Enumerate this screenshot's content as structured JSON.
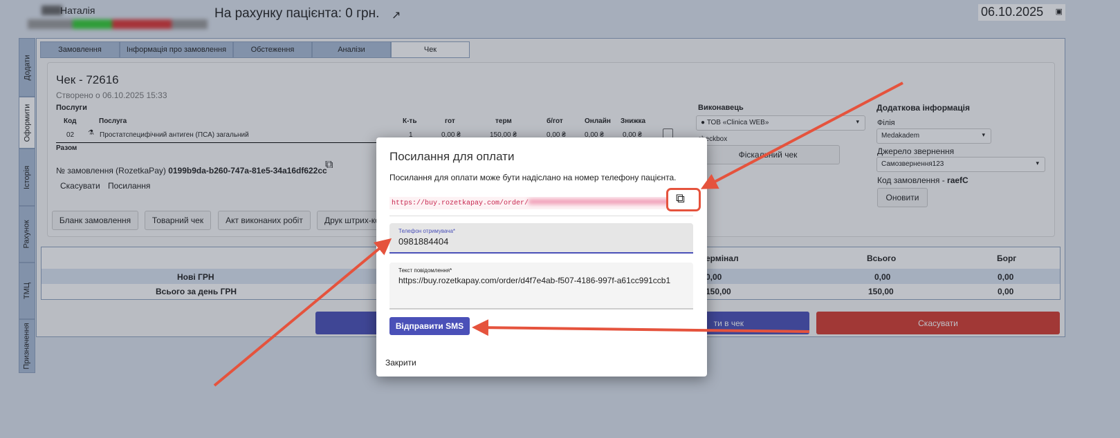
{
  "header": {
    "patient_name": "Наталія",
    "balance": "На рахунку пацієнта: 0 грн.",
    "date": "06.10.2025"
  },
  "side_tabs": [
    "Додати",
    "Оформити",
    "Історія",
    "Рахунок",
    "ТМЦ",
    "Призначення"
  ],
  "tabs": [
    "Замовлення",
    "Інформація про замовлення",
    "Обстеження",
    "Аналізи",
    "Чек"
  ],
  "check": {
    "title": "Чек - 72616",
    "created": "Створено о 06.10.2025 15:33",
    "services_label": "Послуги",
    "columns": [
      "Код",
      "Послуга",
      "К-ть",
      "гот",
      "терм",
      "б/гот",
      "Онлайн",
      "Знижка"
    ],
    "row": [
      "02",
      "Простатспецифічний антиген (ПСА) загальний",
      "1",
      "0,00 ₴",
      "150,00 ₴",
      "0,00 ₴",
      "0,00 ₴",
      "0,00 ₴"
    ],
    "total_label": "Разом",
    "order_label": "№ замовлення (RozetkaPay)",
    "order_id": "0199b9da-b260-747a-81e5-34a16df622cc",
    "links": [
      "Скасувати",
      "Посилання"
    ],
    "buttons": [
      "Бланк замовлення",
      "Товарний чек",
      "Акт виконаних робіт",
      "Друк штрих-ко"
    ]
  },
  "executor": {
    "title": "Виконавець",
    "value": "ТОВ «Clinica WEB»",
    "checkbox_label": "checkbox",
    "fiscal": "Фіскальний чек"
  },
  "extra": {
    "title": "Додаткова інформація",
    "branch_label": "Філія",
    "branch": "Medakadem",
    "source_label": "Джерело звернення",
    "source": "Самозвернення123",
    "code_label": "Код замовлення - ",
    "code": "raefC",
    "refresh": "Оновити"
  },
  "summary": {
    "headers": [
      "ермінал",
      "Всього",
      "Борг"
    ],
    "rows": [
      {
        "label": "Нові ГРН",
        "values": [
          "0,00",
          "0,00",
          "0,00"
        ]
      },
      {
        "label": "Всього за день ГРН",
        "values": [
          "150,00",
          "150,00",
          "0,00"
        ]
      }
    ]
  },
  "bottom": {
    "add": "ти в чек",
    "cancel": "Скасувати"
  },
  "modal": {
    "title": "Посилання для оплати",
    "desc": "Посилання для оплати може бути надіслано на номер телефону пацієнта.",
    "link": "https://buy.rozetkapay.com/order/",
    "phone_label": "Телефон отримувача*",
    "phone": "0981884404",
    "text_label": "Текст повідомлення*",
    "text": "https://buy.rozetkapay.com/order/d4f7e4ab-f507-4186-997f-a61cc991ccb1",
    "send": "Відправити SMS",
    "close": "Закрити"
  },
  "colors": {
    "primary": "#4a50b8",
    "danger": "#d63b30",
    "annotation": "#e5533d"
  }
}
